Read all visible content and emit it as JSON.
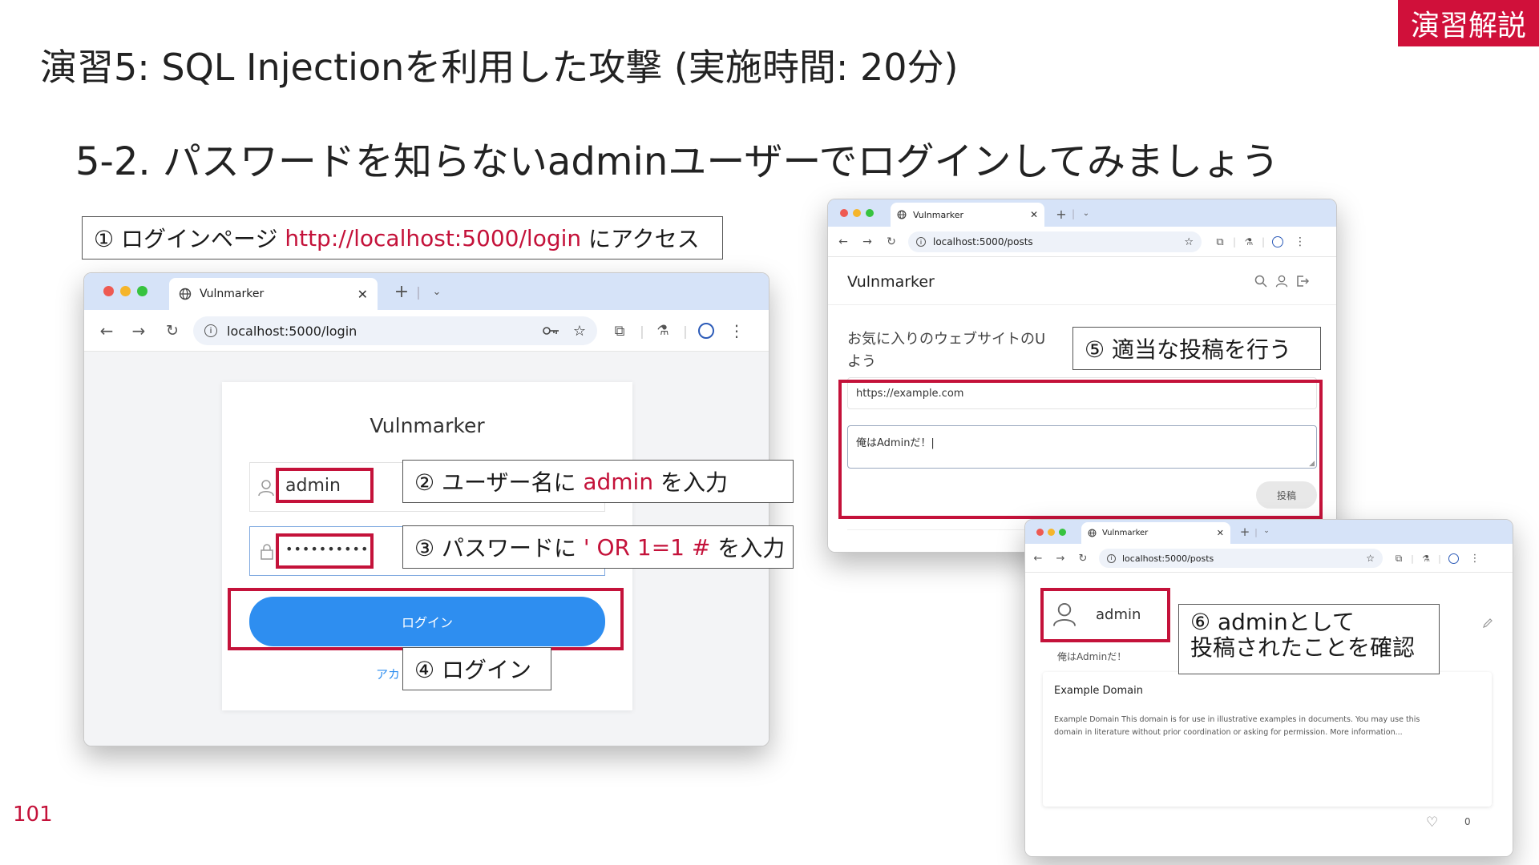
{
  "slide": {
    "badge": "演習解説",
    "title": "演習5: SQL Injectionを利用した攻撃 (実施時間: 20分)",
    "subtitle": "5-2. パスワードを知らないadminユーザーでログインしてみましょう",
    "page_number": "101"
  },
  "callouts": {
    "step1_pre": "① ログインページ ",
    "step1_url": "http://localhost:5000/login",
    "step1_post": " にアクセス",
    "step2_pre": "② ユーザー名に ",
    "step2_val": "admin",
    "step2_post": " を入力",
    "step3_pre": "③ パスワードに ",
    "step3_val": "' OR 1=1 #",
    "step3_post": " を入力",
    "step4": "④ ログイン",
    "step5": "⑤ 適当な投稿を行う",
    "step6_line1": "⑥ adminとして",
    "step6_line2": "投稿されたことを確認"
  },
  "browser_login": {
    "tab_title": "Vulnmarker",
    "url": "localhost:5000/login",
    "app_title": "Vulnmarker",
    "username_value": "admin",
    "password_mask": "••••••••••",
    "login_button": "ログイン",
    "link_partial": "アカ"
  },
  "browser_posts": {
    "tab_title": "Vulnmarker",
    "url": "localhost:5000/posts",
    "app_title": "Vulnmarker",
    "intro_line1": "お気に入りのウェブサイトのU",
    "intro_line2": "よう",
    "url_field_value": "https://example.com",
    "comment_value": "俺はAdminだ！|",
    "submit_button": "投稿"
  },
  "browser_result": {
    "tab_title": "Vulnmarker",
    "url": "localhost:5000/posts",
    "username": "admin",
    "post_comment": "俺はAdminだ！",
    "card_title": "Example Domain",
    "card_desc_line1": "Example Domain This domain is for use in illustrative examples in documents. You may use this",
    "card_desc_line2": "domain in literature without prior coordination or asking for permission. More information...",
    "like_count": "0"
  },
  "colors": {
    "accent_red": "#c4123a",
    "badge_red": "#d0103a",
    "login_blue": "#2e8ef0",
    "tab_strip": "#d6e3f8"
  },
  "icons": [
    "globe-icon",
    "close-icon",
    "plus-icon",
    "chevron-down-icon",
    "back-icon",
    "forward-icon",
    "reload-icon",
    "info-icon",
    "key-icon",
    "star-icon",
    "extension-icon",
    "flask-icon",
    "profile-icon",
    "kebab-icon",
    "user-icon",
    "lock-icon",
    "search-icon",
    "logout-icon",
    "pencil-icon",
    "heart-icon"
  ]
}
